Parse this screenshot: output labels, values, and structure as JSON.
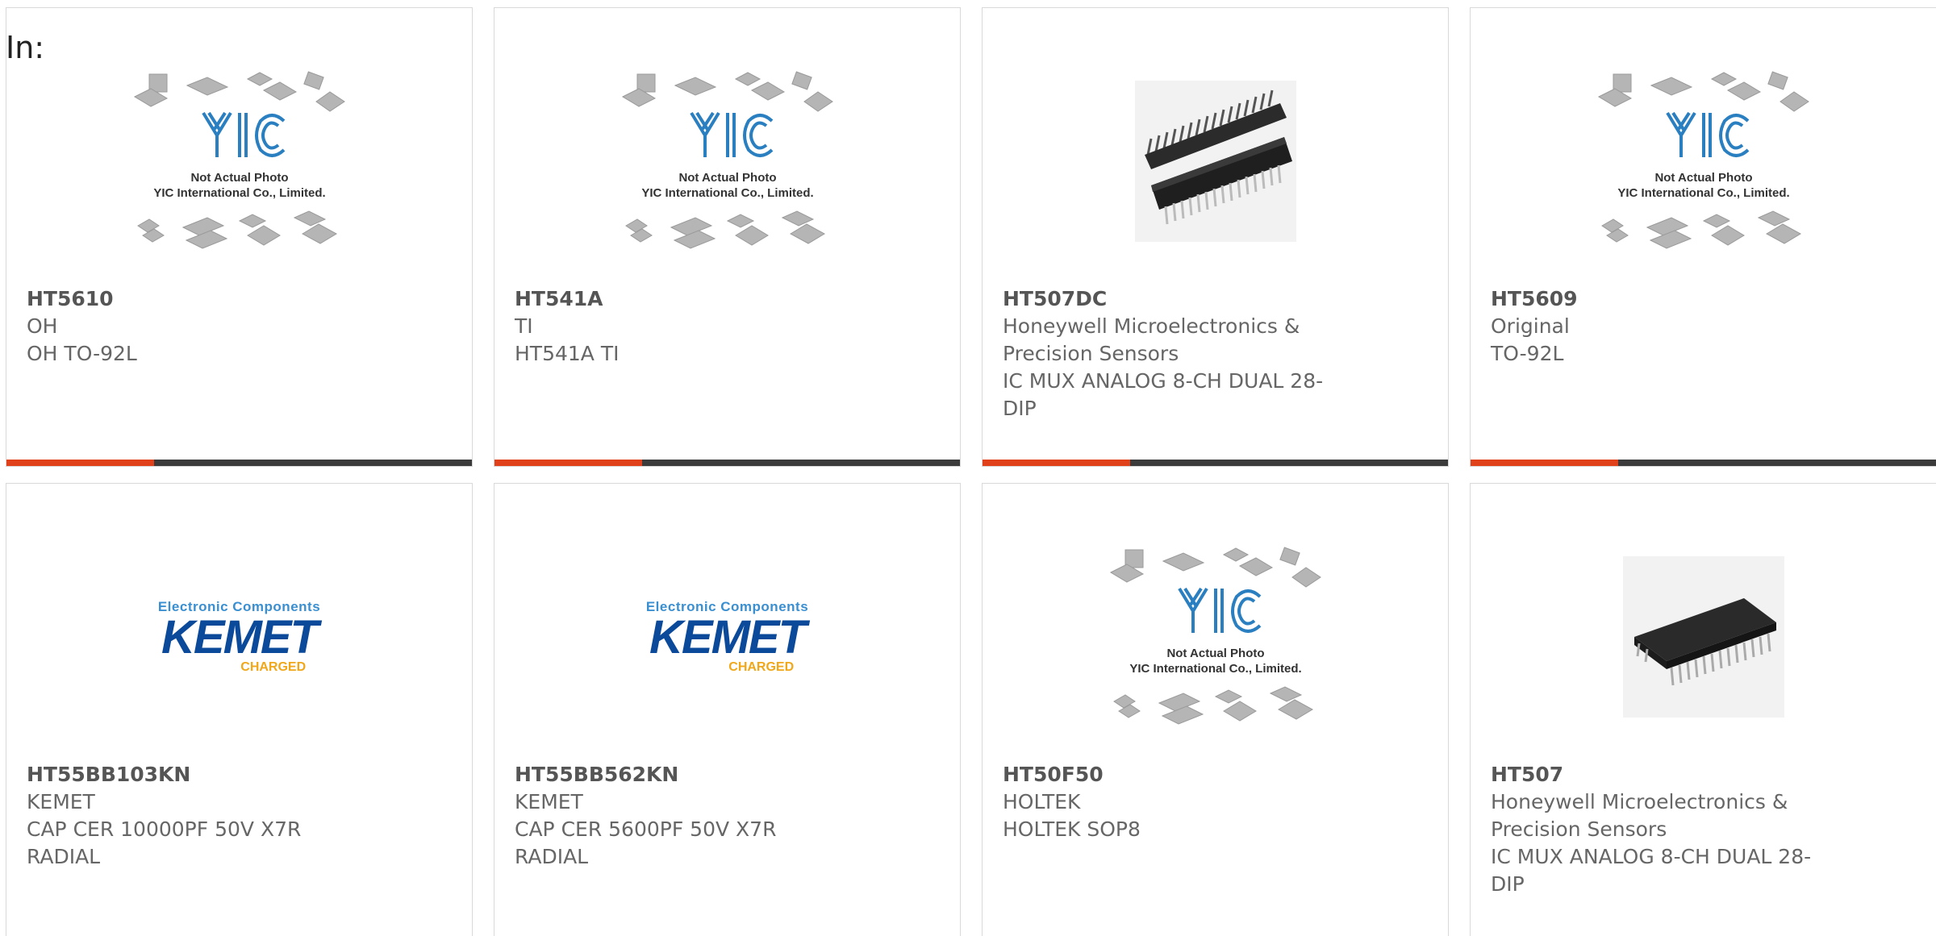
{
  "header": {
    "in_label": "In:"
  },
  "placeholder": {
    "line1": "Not Actual Photo",
    "line2": "YIC International Co., Limited."
  },
  "kemet_logo": {
    "top": "Electronic Components",
    "brand": "KEMET",
    "tagline": "CHARGED"
  },
  "colors": {
    "accent": "#e0401a",
    "bar": "#3b3b3b",
    "text": "#666666"
  },
  "products": [
    {
      "part": "HT5610",
      "maker": "OH",
      "desc": "OH TO-92L",
      "image": "yic-placeholder"
    },
    {
      "part": "HT541A",
      "maker": "TI",
      "desc": "HT541A TI",
      "image": "yic-placeholder"
    },
    {
      "part": "HT507DC",
      "maker": "Honeywell Microelectronics & Precision Sensors",
      "desc": "IC MUX ANALOG 8-CH DUAL 28-DIP",
      "image": "dip-chip-pair"
    },
    {
      "part": "HT5609",
      "maker": "Original",
      "desc": "TO-92L",
      "image": "yic-placeholder"
    },
    {
      "part": "HT55BB103KN",
      "maker": "KEMET",
      "desc": "CAP CER 10000PF 50V X7R RADIAL",
      "image": "kemet-logo"
    },
    {
      "part": "HT55BB562KN",
      "maker": "KEMET",
      "desc": "CAP CER 5600PF 50V X7R RADIAL",
      "image": "kemet-logo"
    },
    {
      "part": "HT50F50",
      "maker": "HOLTEK",
      "desc": "HOLTEK SOP8",
      "image": "yic-placeholder"
    },
    {
      "part": "HT507",
      "maker": "Honeywell Microelectronics & Precision Sensors",
      "desc": "IC MUX ANALOG 8-CH DUAL 28-DIP",
      "image": "dip-chip"
    }
  ]
}
